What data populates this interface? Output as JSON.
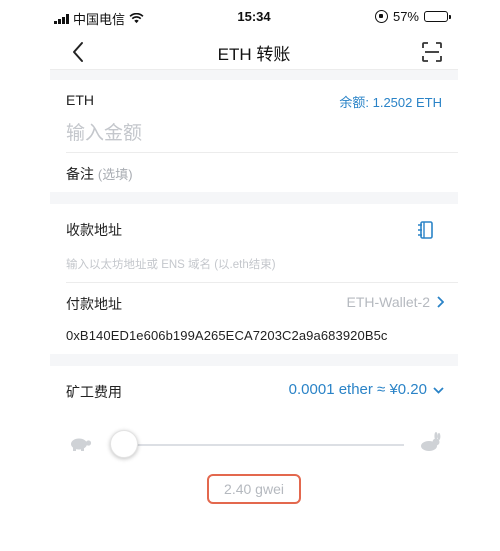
{
  "status_bar": {
    "carrier": "中国电信",
    "time": "15:34",
    "battery": "57%",
    "battery_level": 0.57
  },
  "nav": {
    "title": "ETH 转账"
  },
  "amount_card": {
    "token": "ETH",
    "balance": "余额: 1.2502 ETH",
    "amount_placeholder": "输入金额",
    "memo_label": "备注",
    "memo_hint": "(选填)"
  },
  "address_card": {
    "receive_label": "收款地址",
    "receive_placeholder": "输入以太坊地址或 ENS 域名 (以.eth结束)",
    "pay_label": "付款地址",
    "wallet_name": "ETH-Wallet-2",
    "pay_address": "0xB140ED1e606b199A265ECA7203C2a9a683920B5c"
  },
  "fee_card": {
    "label": "矿工费用",
    "fee": "0.0001 ether ≈ ¥0.20",
    "gas_price": "2.40 gwei",
    "slider_level": 0.02
  },
  "icons": {
    "back": "chevron-left-icon",
    "scan": "scan-icon",
    "address_book": "address-book-icon",
    "chevron_right": "chevron-right-icon",
    "chevron_down": "chevron-down-icon",
    "slow": "turtle-icon",
    "fast": "rabbit-icon"
  },
  "colors": {
    "accent": "#2a83c7",
    "highlight": "#e3684e",
    "placeholder": "#c4c7cc"
  }
}
